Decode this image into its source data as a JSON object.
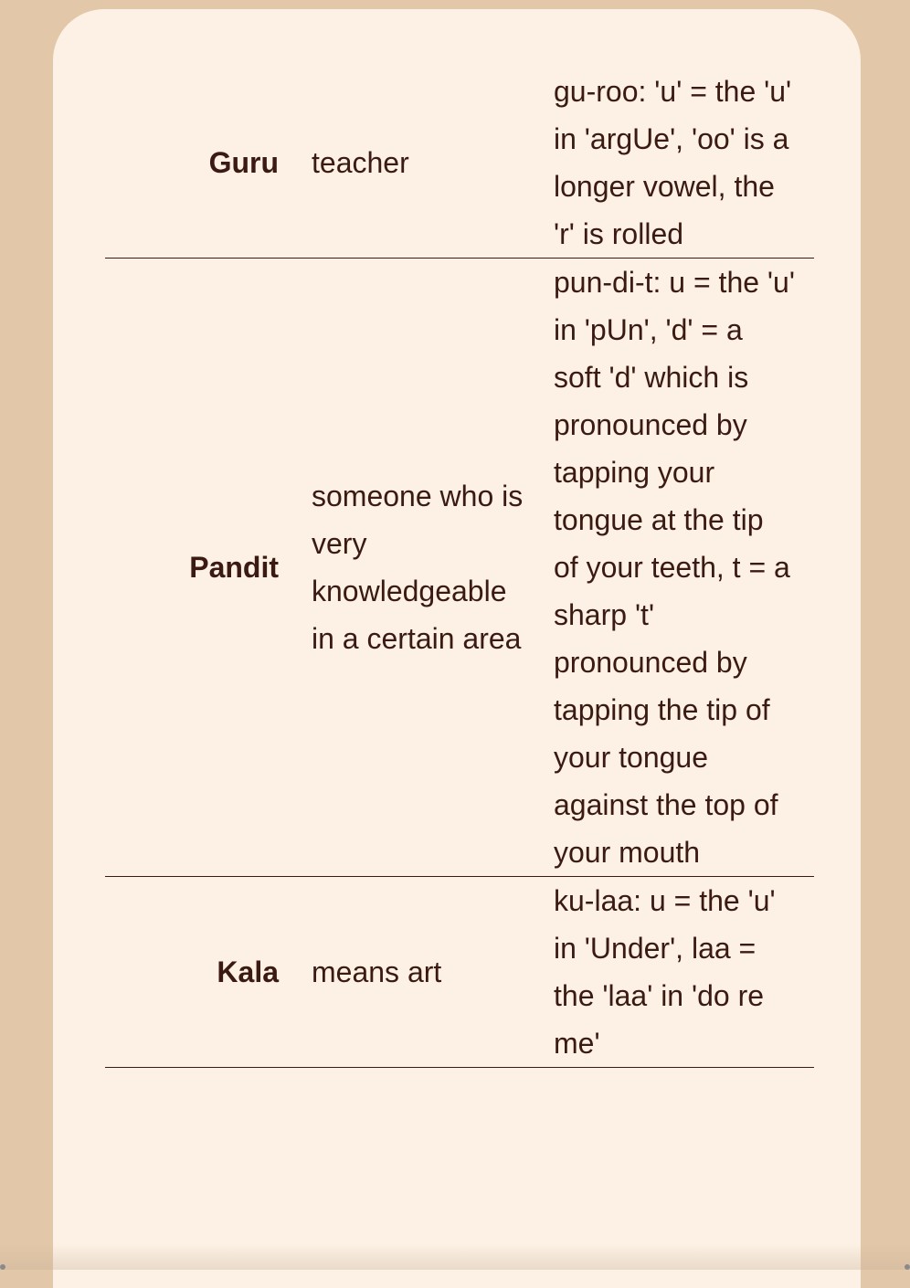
{
  "vocabulary": {
    "rows": [
      {
        "term": "Guru",
        "meaning": "teacher",
        "pronunciation": "gu-roo: 'u' = the 'u' in 'argUe', 'oo' is a longer vowel, the 'r' is rolled"
      },
      {
        "term": "Pandit",
        "meaning": "someone who is very knowledgeable in a certain area",
        "pronunciation": "pun-di-t: u = the 'u' in 'pUn', 'd' = a soft 'd' which is pronounced by tapping your tongue at the tip of your teeth, t = a sharp 't' pronounced by tapping the tip of your tongue against the top of your mouth"
      },
      {
        "term": "Kala",
        "meaning": "means art",
        "pronunciation": "ku-laa: u = the 'u' in 'Under', laa = the 'laa' in 'do re me'"
      }
    ]
  },
  "colors": {
    "page_background": "#e2c7a8",
    "card_background": "#fcf1e4",
    "text": "#3a1a12"
  }
}
